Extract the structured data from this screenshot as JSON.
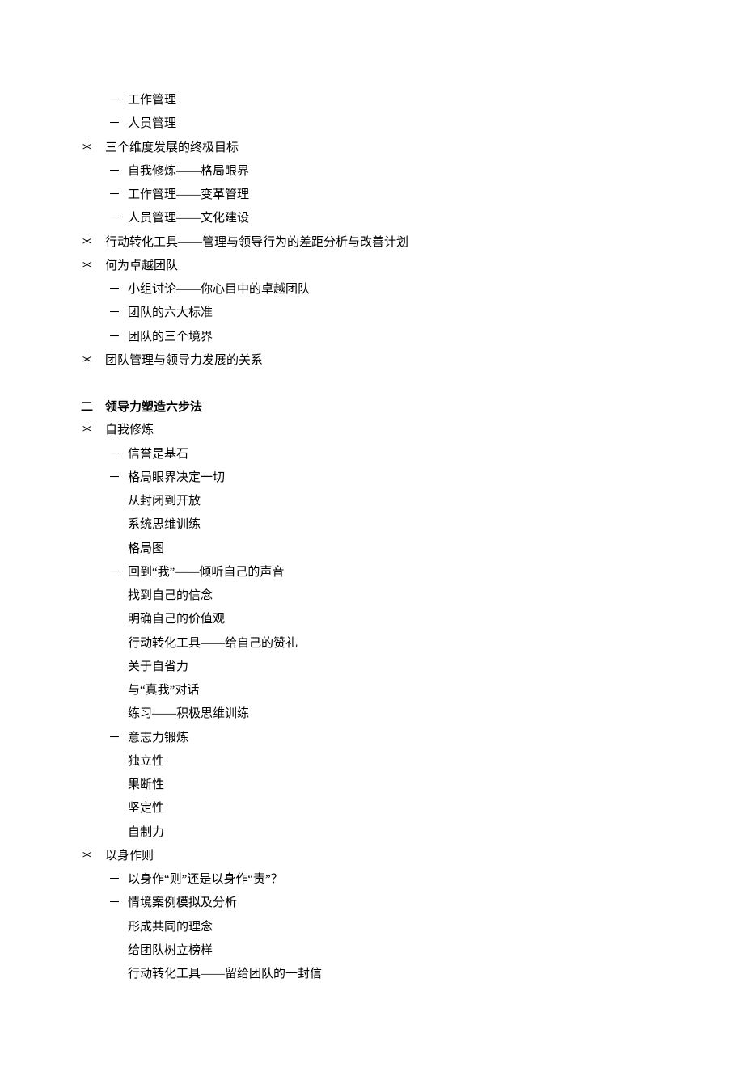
{
  "section1": {
    "items": [
      {
        "level": "l2",
        "bullet": "dash",
        "text": "工作管理"
      },
      {
        "level": "l2",
        "bullet": "dash",
        "text": "人员管理"
      },
      {
        "level": "l1",
        "bullet": "star",
        "text": "三个维度发展的终极目标"
      },
      {
        "level": "l2",
        "bullet": "dash",
        "text": "自我修炼——格局眼界"
      },
      {
        "level": "l2",
        "bullet": "dash",
        "text": "工作管理——变革管理"
      },
      {
        "level": "l2",
        "bullet": "dash",
        "text": "人员管理——文化建设"
      },
      {
        "level": "l1",
        "bullet": "star",
        "text": "行动转化工具——管理与领导行为的差距分析与改善计划"
      },
      {
        "level": "l1",
        "bullet": "star",
        "text": "何为卓越团队"
      },
      {
        "level": "l2",
        "bullet": "dash",
        "text": "小组讨论——你心目中的卓越团队"
      },
      {
        "level": "l2",
        "bullet": "dash",
        "text": "团队的六大标准"
      },
      {
        "level": "l2",
        "bullet": "dash",
        "text": "团队的三个境界"
      },
      {
        "level": "l1",
        "bullet": "star",
        "text": "团队管理与领导力发展的关系"
      }
    ]
  },
  "section2": {
    "heading": "二　领导力塑造六步法",
    "items": [
      {
        "level": "l1",
        "bullet": "star",
        "text": "自我修炼"
      },
      {
        "level": "l2",
        "bullet": "dash",
        "text": "信誉是基石"
      },
      {
        "level": "l2",
        "bullet": "dash",
        "text": "格局眼界决定一切"
      },
      {
        "level": "l3",
        "bullet": "none",
        "text": "从封闭到开放"
      },
      {
        "level": "l3",
        "bullet": "none",
        "text": "系统思维训练"
      },
      {
        "level": "l3",
        "bullet": "none",
        "text": "格局图"
      },
      {
        "level": "l2",
        "bullet": "dash",
        "text": "回到“我”——倾听自己的声音"
      },
      {
        "level": "l3",
        "bullet": "none",
        "text": "找到自己的信念"
      },
      {
        "level": "l3",
        "bullet": "none",
        "text": "明确自己的价值观"
      },
      {
        "level": "l3",
        "bullet": "none",
        "text": "行动转化工具——给自己的赞礼"
      },
      {
        "level": "l3",
        "bullet": "none",
        "text": "关于自省力"
      },
      {
        "level": "l3",
        "bullet": "none",
        "text": "与“真我”对话"
      },
      {
        "level": "l3",
        "bullet": "none",
        "text": "练习——积极思维训练"
      },
      {
        "level": "l2",
        "bullet": "dash",
        "text": "意志力锻炼"
      },
      {
        "level": "l3",
        "bullet": "none",
        "text": "独立性"
      },
      {
        "level": "l3",
        "bullet": "none",
        "text": "果断性"
      },
      {
        "level": "l3",
        "bullet": "none",
        "text": "坚定性"
      },
      {
        "level": "l3",
        "bullet": "none",
        "text": "自制力"
      },
      {
        "level": "l1",
        "bullet": "star",
        "text": "以身作则"
      },
      {
        "level": "l2",
        "bullet": "dash",
        "text": "以身作“则”还是以身作“责”？"
      },
      {
        "level": "l2",
        "bullet": "dash",
        "text": "情境案例模拟及分析"
      },
      {
        "level": "l3",
        "bullet": "none",
        "text": "形成共同的理念"
      },
      {
        "level": "l3",
        "bullet": "none",
        "text": "给团队树立榜样"
      },
      {
        "level": "l3",
        "bullet": "none",
        "text": "行动转化工具——留给团队的一封信"
      }
    ]
  }
}
